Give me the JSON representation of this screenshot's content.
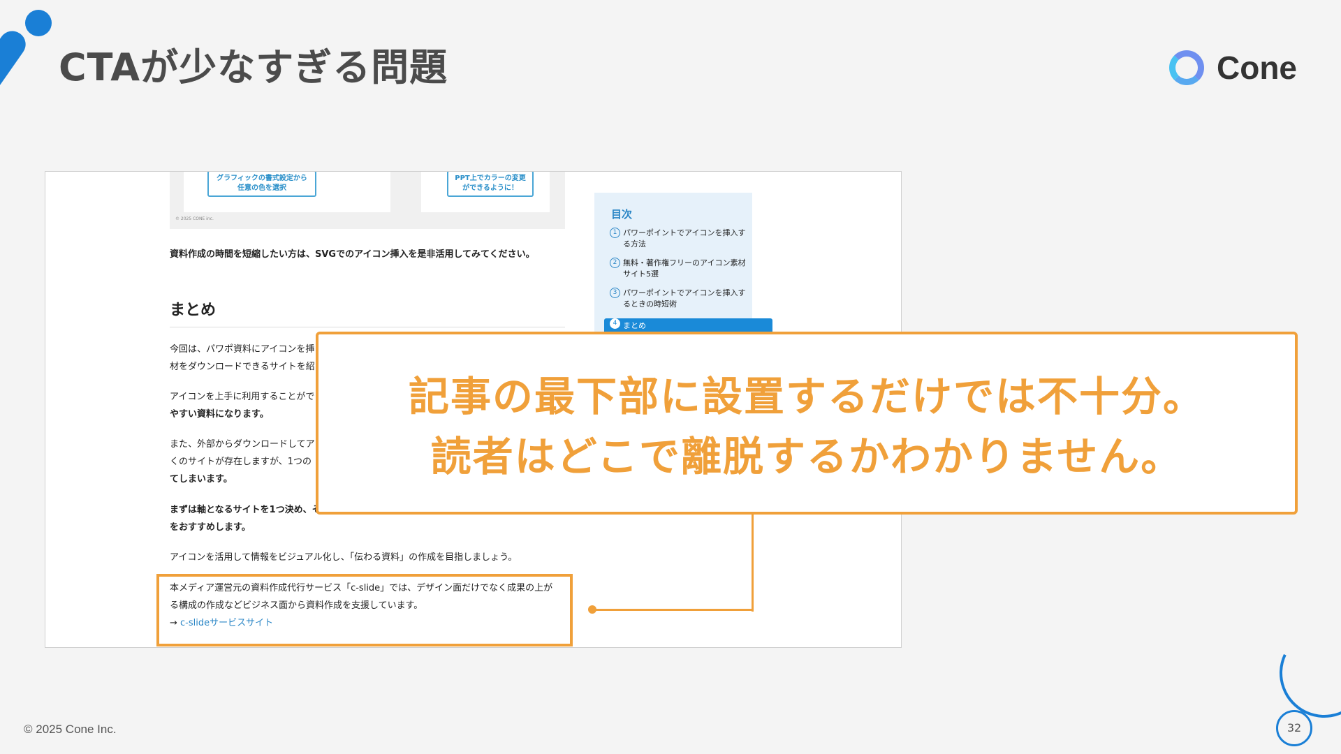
{
  "header": {
    "title": "CTAが少なすぎる問題",
    "logo_text": "Cone"
  },
  "screenshot": {
    "image_callouts": [
      "グラフィックの書式設定から\n任意の色を選択",
      "PPT上でカラーの変更\nができるように！"
    ],
    "image_copyright": "© 2025 CONE inc.",
    "intro_line": "資料作成の時間を短縮したい方は、SVGでのアイコン挿入を是非活用してみてください。",
    "section_heading": "まとめ",
    "paragraphs": [
      [
        "今回は、パワポ資料にアイコンを挿",
        "材をダウンロードできるサイトを紹"
      ],
      [
        "アイコンを上手に利用することがで",
        "やすい資料になります。"
      ],
      [
        "また、外部からダウンロードしてア",
        "くのサイトが存在しますが、1つの",
        "てしまいます。"
      ],
      [
        "まずは軸となるサイトを1つ決め、そ",
        "をおすすめします。"
      ]
    ],
    "closing_line": "アイコンを活用して情報をビジュアル化し、「伝わる資料」の作成を目指しましょう。",
    "cta_text_1": "本メディア運営元の資料作成代行サービス「c-slide」では、デザイン面だけでなく成果の上が",
    "cta_text_2": "る構成の作成などビジネス面から資料作成を支援しています。",
    "cta_arrow": "→ ",
    "cta_link": "c-slideサービスサイト",
    "toc": {
      "title": "目次",
      "items": [
        {
          "num": "1",
          "text": "パワーポイントでアイコンを挿入す\nる方法"
        },
        {
          "num": "2",
          "text": "無料・著作権フリーのアイコン素材\nサイト5選"
        },
        {
          "num": "3",
          "text": "パワーポイントでアイコンを挿入す\nるときの時短術"
        }
      ],
      "active": {
        "num": "4",
        "text": "まとめ"
      }
    }
  },
  "message": {
    "line1": "記事の最下部に設置するだけでは不十分。",
    "line2": "読者はどこで離脱するかわかりません。"
  },
  "footer": {
    "copyright": "© 2025 Cone Inc.",
    "page": "32"
  },
  "colors": {
    "accent_orange": "#f0a03a",
    "brand_blue": "#1a7fd6",
    "link_blue": "#2a86c6"
  }
}
